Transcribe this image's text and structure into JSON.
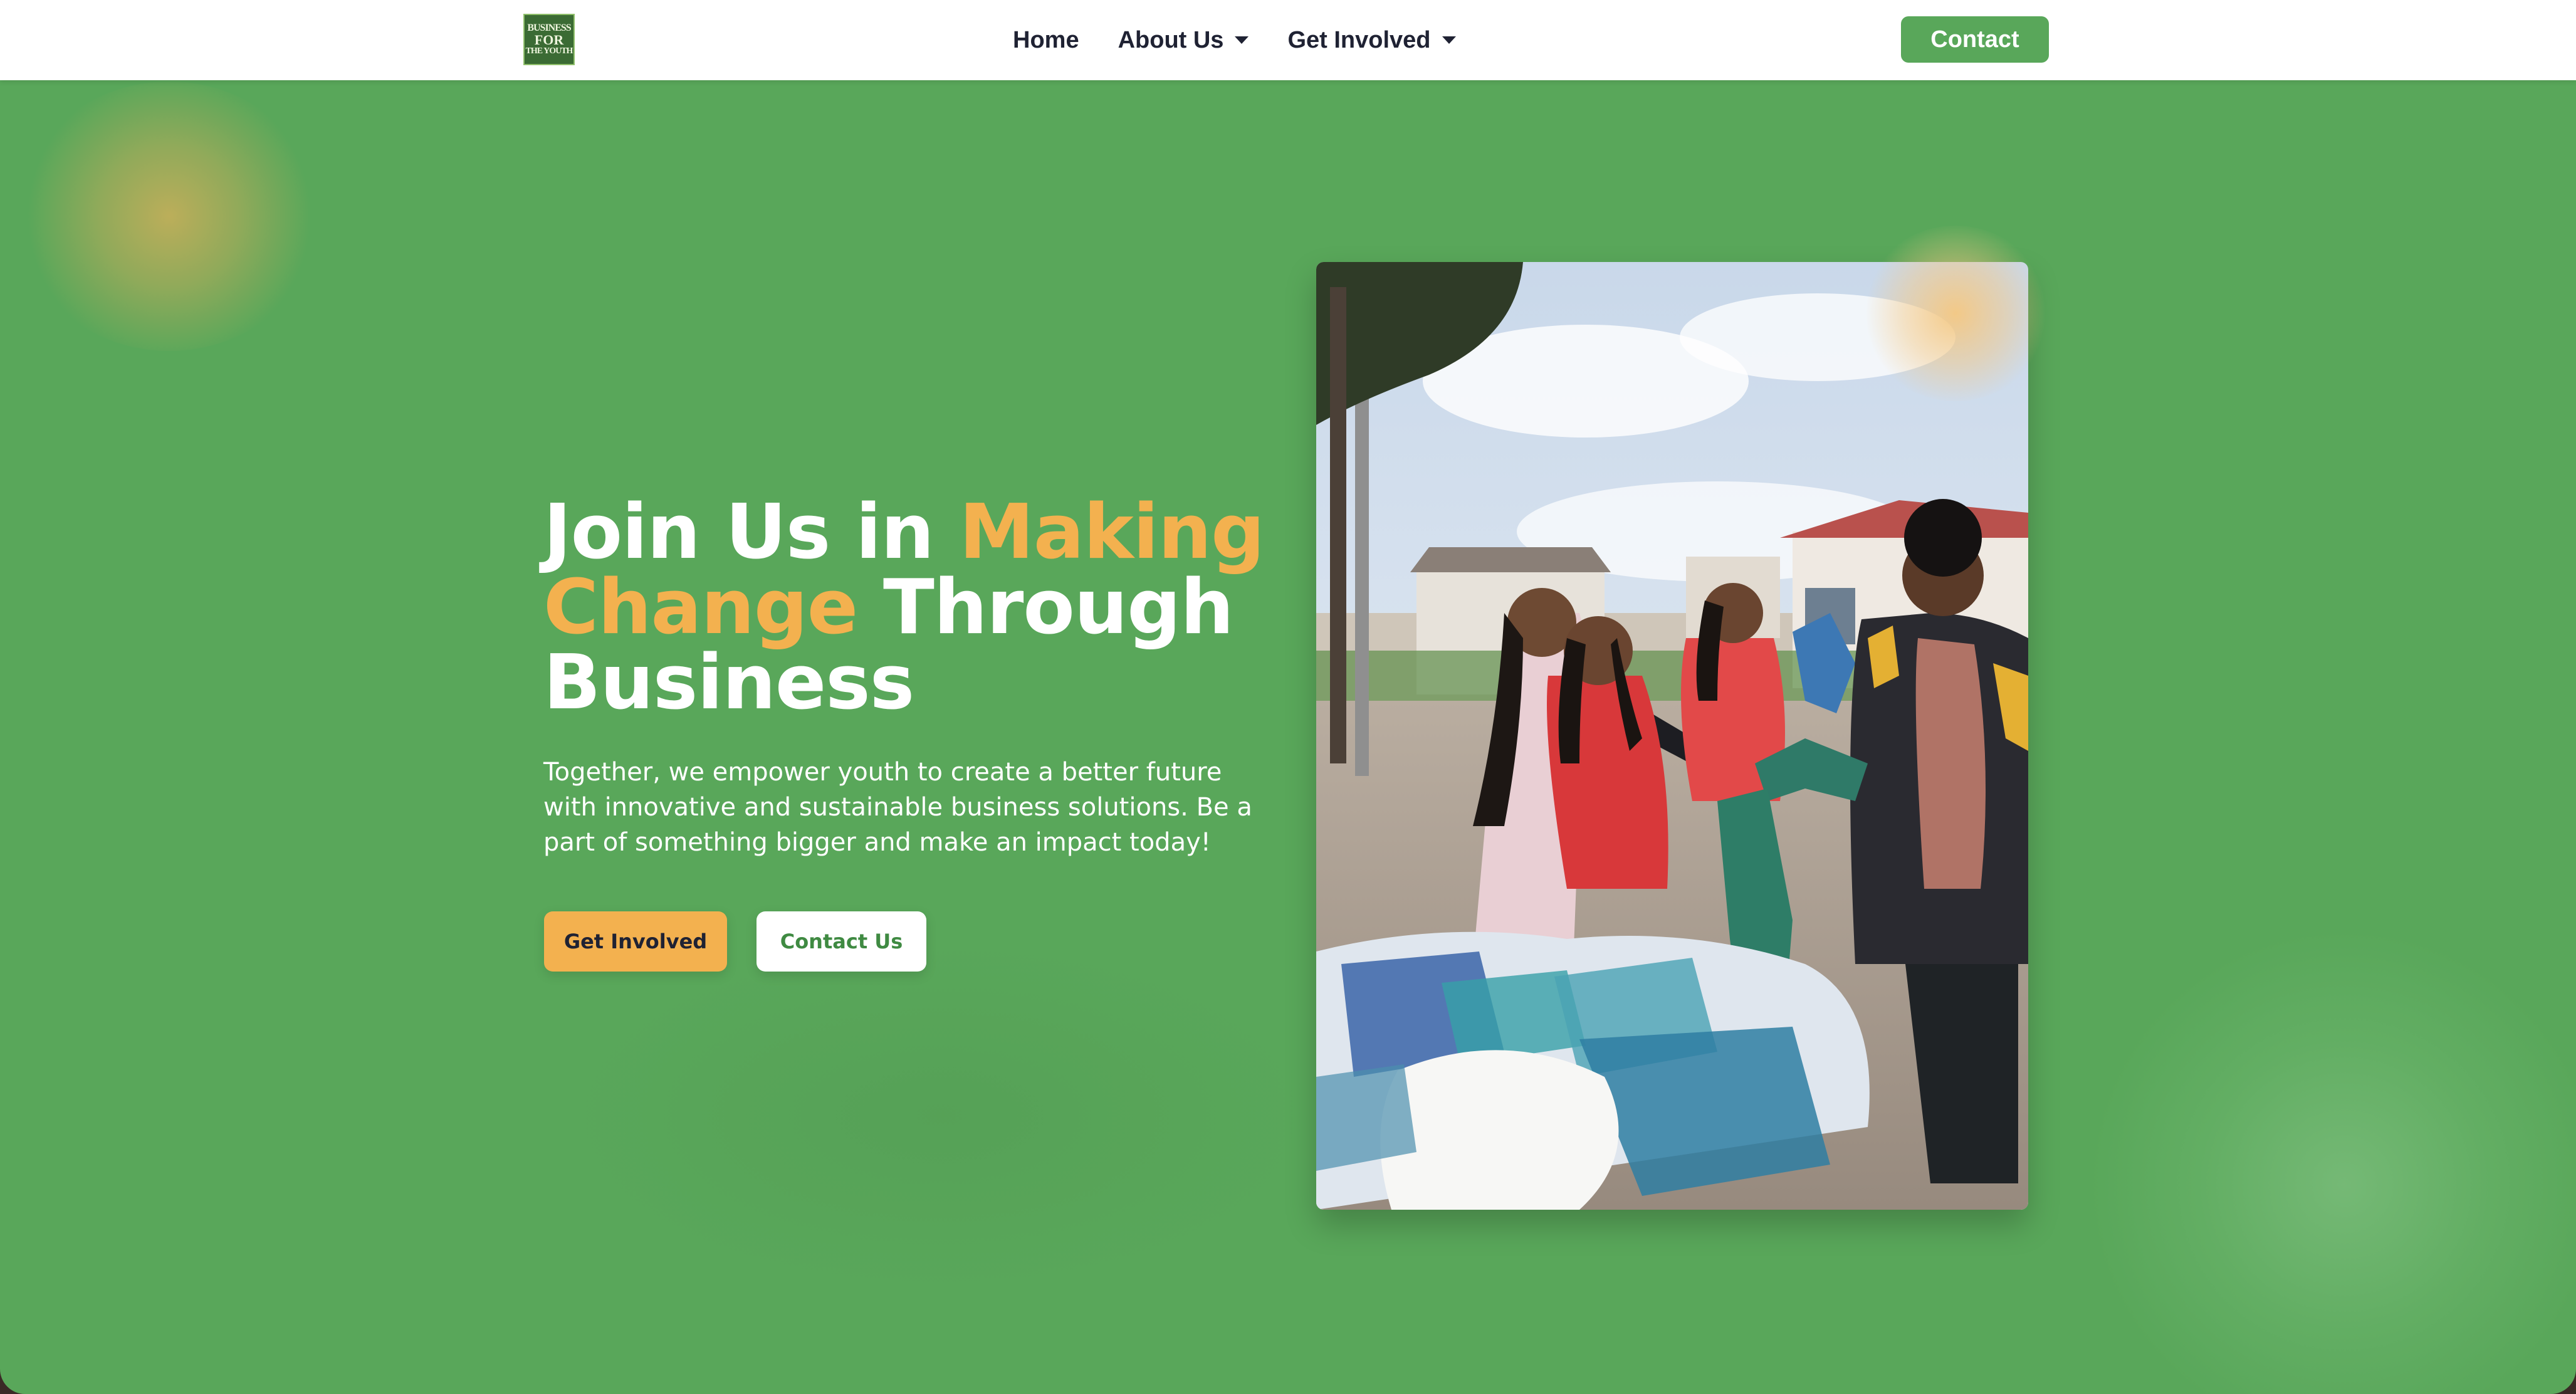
{
  "brand": {
    "logo_lines": [
      "BUSINESS",
      "FOR",
      "THE YOUTH"
    ]
  },
  "nav": {
    "items": [
      {
        "label": "Home",
        "has_dropdown": false
      },
      {
        "label": "About Us",
        "has_dropdown": true
      },
      {
        "label": "Get Involved",
        "has_dropdown": true
      }
    ],
    "contact_label": "Contact"
  },
  "hero": {
    "title_part1": "Join Us in ",
    "title_accent": "Making Change",
    "title_part2": " Through Business",
    "subtitle": "Together, we empower youth to create a better future with innovative and sustainable business solutions. Be a part of something bigger and make an impact today!",
    "primary_button": "Get Involved",
    "secondary_button": "Contact Us"
  },
  "colors": {
    "brand_green": "#59a75a",
    "accent_orange": "#f3b14f",
    "nav_text": "#1f2233",
    "white": "#ffffff"
  },
  "icons": {
    "dropdown": "caret-down-icon"
  }
}
